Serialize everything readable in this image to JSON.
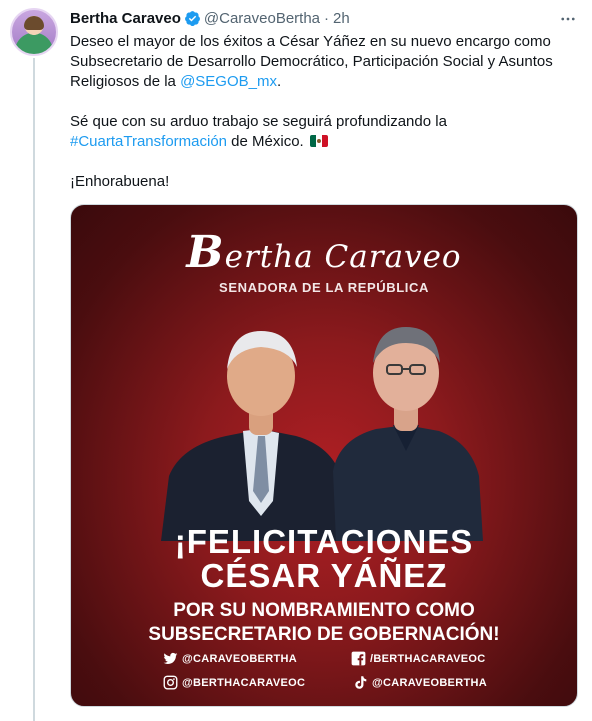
{
  "author": {
    "name": "Bertha Caraveo",
    "handle": "@CaraveoBertha",
    "separator": "·",
    "time": "2h"
  },
  "tweet": {
    "line1_pre": "Deseo el mayor de los éxitos a César Yáñez en su nuevo encargo como Subsecretario de Desarrollo Democrático, Participación Social y Asuntos Religiosos de la ",
    "mention": "@SEGOB_mx",
    "line1_post": ".",
    "line2_pre": "Sé que con su arduo trabajo se seguirá profundizando la ",
    "hashtag": "#CuartaTransformación",
    "line2_post": " de México.",
    "line3": "¡Enhorabuena!"
  },
  "media": {
    "brand_initial": "B",
    "brand_rest": "ertha Caraveo",
    "brand_subtitle": "SENADORA DE LA REPÚBLICA",
    "headline_1": "¡FELICITACIONES",
    "headline_2": "CÉSAR YÁÑEZ",
    "headline_3": "POR SU NOMBRAMIENTO COMO",
    "headline_4": "SUBSECRETARIO DE GOBERNACIÓN!",
    "socials": {
      "twitter": "@CARAVEOBERTHA",
      "facebook": "/BERTHACARAVEOC",
      "instagram": "@BERTHACARAVEOC",
      "tiktok": "@CARAVEOBERTHA"
    }
  },
  "colors": {
    "link": "#1d9bf0",
    "secondary_text": "#536471",
    "verified": "#1d9bf0",
    "media_red": "#8c1a1d"
  },
  "icons": [
    "verified-badge-icon",
    "more-options-icon",
    "twitter-icon",
    "facebook-icon",
    "instagram-icon",
    "tiktok-icon",
    "mexico-flag-icon"
  ]
}
